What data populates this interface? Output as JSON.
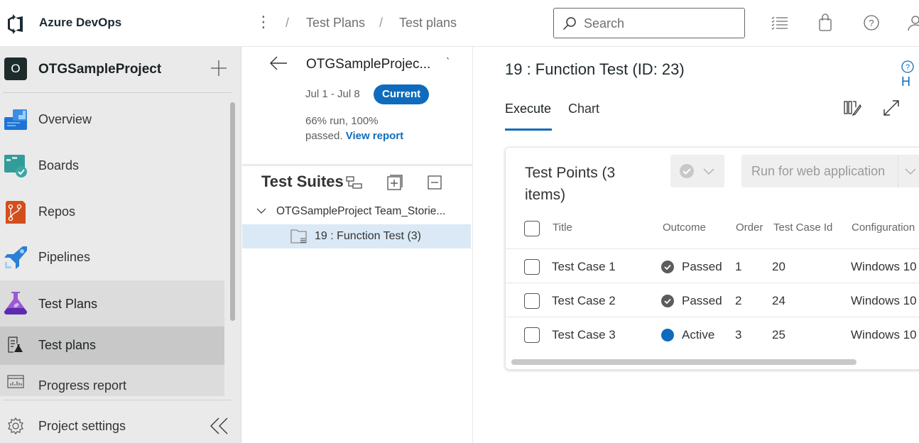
{
  "topbar": {
    "brand": "Azure DevOps",
    "breadcrumb": [
      "Test Plans",
      "Test plans"
    ],
    "search_placeholder": "Search"
  },
  "sidebar": {
    "project_initial": "O",
    "project_name": "OTGSampleProject",
    "items": [
      {
        "label": "Overview",
        "icon": "overview-icon"
      },
      {
        "label": "Boards",
        "icon": "boards-icon"
      },
      {
        "label": "Repos",
        "icon": "repos-icon"
      },
      {
        "label": "Pipelines",
        "icon": "pipelines-icon"
      },
      {
        "label": "Test Plans",
        "icon": "test-plans-icon"
      },
      {
        "label": "Test plans",
        "icon": "test-plans-sub-icon"
      },
      {
        "label": "Progress report",
        "icon": "progress-report-icon"
      }
    ],
    "settings_label": "Project settings"
  },
  "plan": {
    "name": "OTGSampleProjec...",
    "dates": "Jul 1 - Jul 8",
    "badge": "Current",
    "stats_text": "66% run, 100% passed.",
    "report_link": "View report",
    "run_percent": 66,
    "passed_percent": 100
  },
  "suites": {
    "title": "Test Suites",
    "root": "OTGSampleProject Team_Storie...",
    "child": "19 : Function Test (3)"
  },
  "main": {
    "title": "19 : Function Test (ID: 23)",
    "help_label": "H",
    "tabs": [
      "Execute",
      "Chart"
    ],
    "active_tab": "Execute",
    "card_title": "Test Points (3 items)",
    "run_button": "Run for web application",
    "columns": [
      "Title",
      "Outcome",
      "Order",
      "Test Case Id",
      "Configuration"
    ],
    "rows": [
      {
        "title": "Test Case 1",
        "outcome": "Passed",
        "order": "1",
        "test_case_id": "20",
        "configuration": "Windows 10"
      },
      {
        "title": "Test Case 2",
        "outcome": "Passed",
        "order": "2",
        "test_case_id": "24",
        "configuration": "Windows 10"
      },
      {
        "title": "Test Case 3",
        "outcome": "Active",
        "order": "3",
        "test_case_id": "25",
        "configuration": "Windows 10"
      }
    ]
  },
  "colors": {
    "accent": "#0f6cbd",
    "passed": "#5c5c5c",
    "active": "#0f6cbd",
    "selected_suite": "#dbe9f6"
  }
}
